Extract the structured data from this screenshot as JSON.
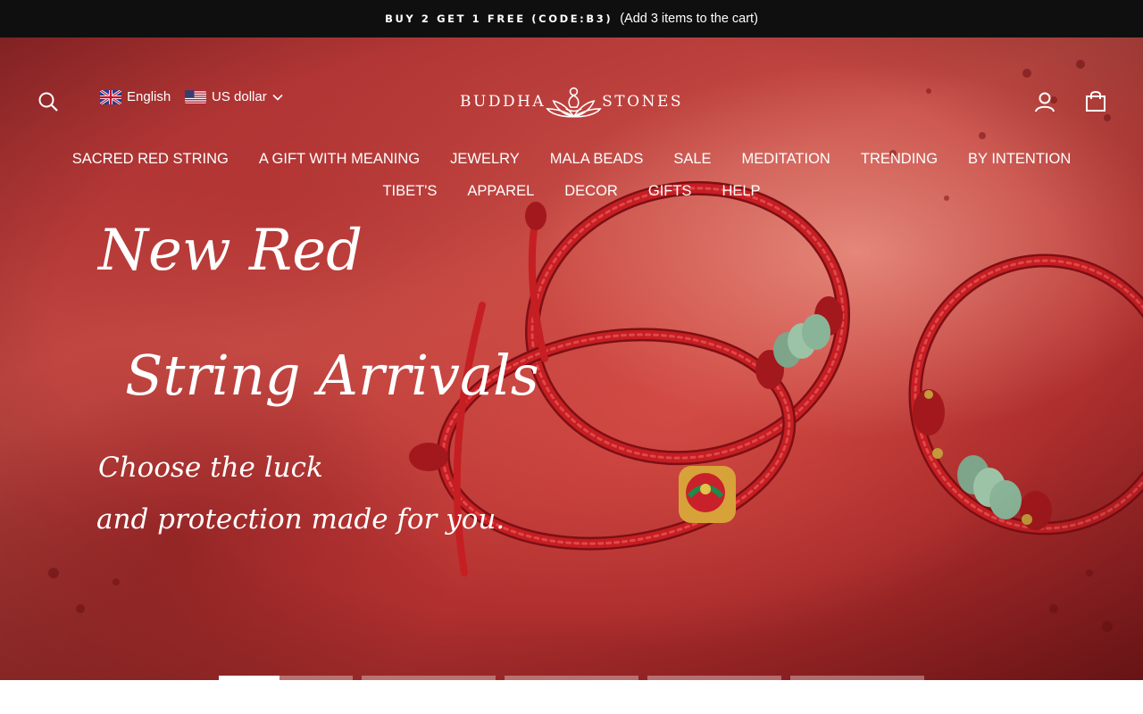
{
  "announcement": {
    "code_text": "BUY 2 GET 1 FREE (CODE:B3)",
    "note_text": "(Add 3 items to the cart)"
  },
  "header": {
    "search_icon": "search-icon",
    "language": "English",
    "currency": "US dollar",
    "logo_left": "BUDDHA",
    "logo_right": "STONES",
    "account_icon": "account-icon",
    "cart_icon": "cart-icon"
  },
  "nav": {
    "row1": [
      "SACRED RED STRING",
      "A GIFT WITH MEANING",
      "JEWELRY",
      "MALA BEADS",
      "SALE",
      "MEDITATION",
      "TRENDING",
      "BY INTENTION"
    ],
    "row2": [
      "TIBET'S",
      "APPAREL",
      "DECOR",
      "GIFTS",
      "HELP"
    ]
  },
  "hero": {
    "line1": "New Red",
    "line2": "String Arrivals",
    "sub1": "Choose the luck",
    "sub2": "and protection made for you."
  },
  "slideshow": {
    "count": 5,
    "active_index": 0,
    "active_progress": 0.45
  },
  "colors": {
    "announcement_bg": "#0f0f0f",
    "hero_red": "#b93533",
    "cord_red": "#c51f23",
    "jade": "#8fb89a"
  }
}
